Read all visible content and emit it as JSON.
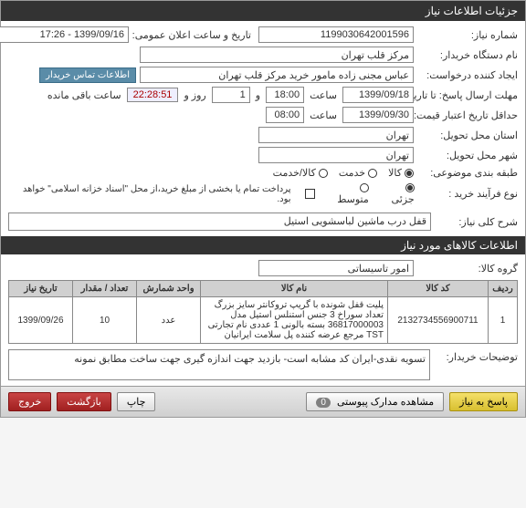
{
  "header": {
    "title": "جزئیات اطلاعات نیاز"
  },
  "info": {
    "need_no_label": "شماره نیاز:",
    "need_no": "1199030642001596",
    "announce_label": "تاریخ و ساعت اعلان عمومی:",
    "announce": "1399/09/16 - 17:26",
    "buyer_org_label": "نام دستگاه خریدار:",
    "buyer_org": "مرکز قلب تهران",
    "creator_label": "ایجاد کننده درخواست:",
    "creator": "عباس  مجنی زاده مامور خرید مرکز قلب تهران",
    "contact_btn": "اطلاعات تماس خریدار",
    "deadline_reply_label": "مهلت ارسال پاسخ: تا تاریخ:",
    "deadline_reply_date": "1399/09/18",
    "hour_label": "ساعت",
    "deadline_reply_time": "18:00",
    "and_label": "و",
    "days_label": "روز و",
    "days_remain": "1",
    "time_remain": "22:28:51",
    "remain_suffix": "ساعت باقی مانده",
    "deadline_price_label": "حداقل تاریخ اعتبار قیمت: تا تاریخ:",
    "deadline_price_date": "1399/09/30",
    "deadline_price_time": "08:00",
    "delivery_state_label": "استان محل تحویل:",
    "delivery_state": "تهران",
    "delivery_city_label": "شهر محل تحویل:",
    "delivery_city": "تهران",
    "budget_label": "طبقه بندی موضوعی:",
    "budget_goods": "کالا",
    "budget_service": "خدمت",
    "budget_mixed": "کالا/خدمت",
    "purchase_type_label": "نوع فرآیند خرید :",
    "pt_small": "جزئی",
    "pt_medium": "متوسط",
    "pt_note": "پرداخت تمام یا بخشی از مبلغ خرید،از محل \"اسناد خزانه اسلامی\" خواهد بود.",
    "summary_label": "شرح کلی نیاز:",
    "summary": "قفل درب ماشین لباسشویی استیل"
  },
  "items_section": {
    "title": "اطلاعات کالاهای مورد نیاز",
    "group_label": "گروه کالا:",
    "group": "امور تاسیساتی",
    "headers": {
      "row": "ردیف",
      "code": "کد کالا",
      "name": "نام کالا",
      "count": "واحد شمارش",
      "qty": "تعداد / مقدار",
      "need_date": "تاریخ نیاز"
    },
    "rows": [
      {
        "row": "1",
        "code": "2132734556900711",
        "name": "پلیت قفل شونده با گریپ تروکانتر سایز بزرگ تعداد سوراخ 3 جنس استنلس استیل مدل 36817000003 بسته بالونی 1 عددی نام تجارتی TST مرجع عرضه کننده پل سلامت ایرانیان",
        "count": "عدد",
        "qty": "10",
        "need_date": "1399/09/26"
      }
    ]
  },
  "buyer_note": {
    "label": "توضیحات خریدار:",
    "text": "تسویه نقدی-ایران کد مشابه است- بازدید جهت اندازه گیری جهت ساخت مطابق نمونه"
  },
  "footer": {
    "reply": "پاسخ به نیاز",
    "attachments": "مشاهده مدارک پیوستی",
    "attachments_count": "0",
    "print": "چاپ",
    "back": "بازگشت",
    "exit": "خروج"
  }
}
